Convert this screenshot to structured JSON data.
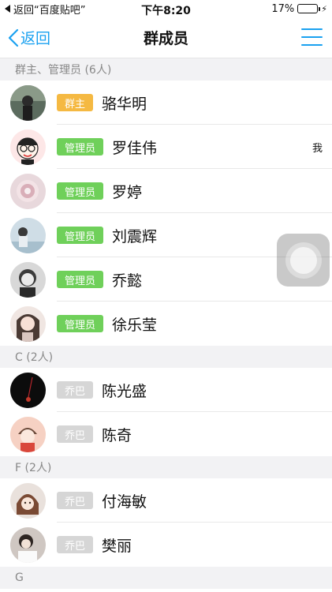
{
  "status_bar": {
    "back_app": "返回“百度贴吧”",
    "time": "下午8:20",
    "battery_pct": "17%",
    "battery_level": 0.17
  },
  "nav": {
    "back_label": "返回",
    "title": "群成员"
  },
  "colors": {
    "accent": "#1aa1f0",
    "owner_badge": "#f5b942",
    "admin_badge": "#6fd05a",
    "member_badge": "#d6d6d6",
    "section_bg": "#f2f2f4"
  },
  "sections": [
    {
      "header": "群主、管理员 (6人)",
      "members": [
        {
          "name": "骆华明",
          "role": "群主",
          "role_type": "owner",
          "me": ""
        },
        {
          "name": "罗佳伟",
          "role": "管理员",
          "role_type": "admin",
          "me": "我"
        },
        {
          "name": "罗婷",
          "role": "管理员",
          "role_type": "admin",
          "me": ""
        },
        {
          "name": "刘震辉",
          "role": "管理员",
          "role_type": "admin",
          "me": ""
        },
        {
          "name": "乔懿",
          "role": "管理员",
          "role_type": "admin",
          "me": ""
        },
        {
          "name": "徐乐莹",
          "role": "管理员",
          "role_type": "admin",
          "me": ""
        }
      ]
    },
    {
      "header": "C (2人)",
      "members": [
        {
          "name": "陈光盛",
          "role": "乔巴",
          "role_type": "member",
          "me": ""
        },
        {
          "name": "陈奇",
          "role": "乔巴",
          "role_type": "member",
          "me": ""
        }
      ]
    },
    {
      "header": "F (2人)",
      "members": [
        {
          "name": "付海敏",
          "role": "乔巴",
          "role_type": "member",
          "me": ""
        },
        {
          "name": "樊丽",
          "role": "乔巴",
          "role_type": "member",
          "me": ""
        }
      ]
    },
    {
      "header": "G",
      "members": []
    }
  ]
}
